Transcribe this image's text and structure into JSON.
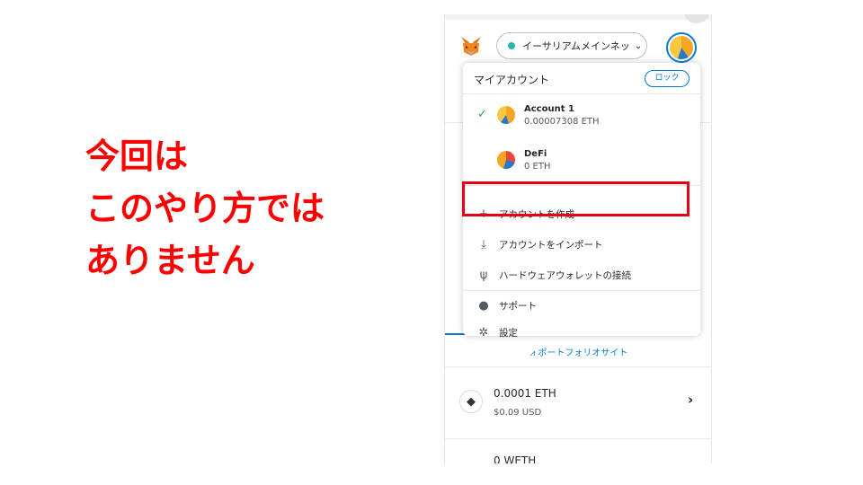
{
  "annotation": {
    "lines": [
      "今回は",
      "このやり方では",
      "ありません"
    ],
    "color": "#ff0000"
  },
  "header": {
    "network_label": "イーサリアムメインネッ...",
    "network_dot_color": "#29b6af",
    "network_chevron": "⌄"
  },
  "menu": {
    "title": "マイアカウント",
    "lock_label": "ロック",
    "accounts": [
      {
        "selected": true,
        "name": "Account 1",
        "balance": "0.00007308 ETH"
      },
      {
        "selected": false,
        "name": "DeFi",
        "balance": "0 ETH"
      }
    ],
    "check_icon": "✓",
    "items": [
      {
        "icon": "+",
        "label": "アカウントを作成"
      },
      {
        "icon": "⤓",
        "label": "アカウントをインポート"
      },
      {
        "icon": "ψ",
        "label": "ハードウェアウォレットの接続"
      },
      {
        "icon": "●",
        "label": "サポート"
      },
      {
        "icon": "✲",
        "label": "設定"
      }
    ]
  },
  "page": {
    "portfolio_link": "ポートフォリオサイト",
    "asset": {
      "amount": "0.0001 ETH",
      "usd": "$0.09 USD",
      "icon": "◆"
    },
    "next_asset": "0 WETH"
  },
  "colors": {
    "accent": "#037dd6",
    "highlight": "#e60012"
  }
}
